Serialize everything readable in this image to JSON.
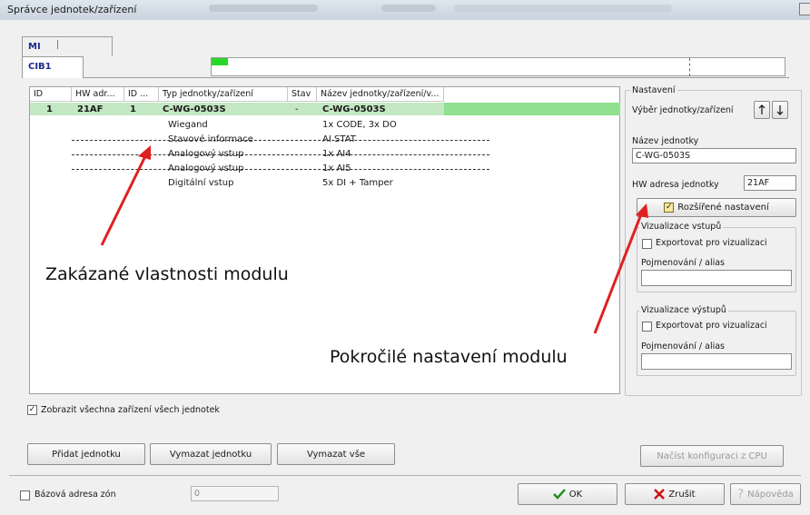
{
  "window": {
    "title": "Správce jednotek/zařízení"
  },
  "tabs": {
    "top": "MI",
    "bottom": "CIB1"
  },
  "colors": {
    "progress": "#28d828",
    "row_highlight": "#c3e8c3",
    "row_highlight_right": "#8fe08f",
    "arrow": "#e02020",
    "ok_check": "#1a8a1a",
    "cancel_x": "#cc1010"
  },
  "table": {
    "columns": [
      "ID",
      "HW adr...",
      "ID ...",
      "Typ jednotky/zařízení",
      "Stav",
      "Název jednotky/zařízení/v..."
    ],
    "main_row": {
      "id": "1",
      "hw": "21AF",
      "id2": "1",
      "type": "C-WG-0503S",
      "state": "-",
      "name": "C-WG-0503S"
    },
    "sub_rows": [
      {
        "type": "Wiegand",
        "name": "1x CODE, 3x DO",
        "disabled": false
      },
      {
        "type": "Stavové informace",
        "name": "AI STAT",
        "disabled": true
      },
      {
        "type": "Analogový vstup",
        "name": "1x AI4",
        "disabled": true
      },
      {
        "type": "Analogový vstup",
        "name": "1x AI5",
        "disabled": true
      },
      {
        "type": "Digitální vstup",
        "name": "5x DI + Tamper",
        "disabled": false
      }
    ]
  },
  "panel": {
    "group_title": "Nastavení",
    "select_label": "Výběr jednotky/zařízení",
    "name_label": "Název jednotky",
    "name_value": "C-WG-0503S",
    "hw_label": "HW adresa jednotky",
    "hw_value": "21AF",
    "advanced_button": "Rozšířené nastavení",
    "inputs_group": "Vizualizace vstupů",
    "inputs_export": "Exportovat pro vizualizaci",
    "inputs_alias_label": "Pojmenování / alias",
    "outputs_group": "Vizualizace výstupů",
    "outputs_export": "Exportovat pro vizualizaci",
    "outputs_alias_label": "Pojmenování / alias"
  },
  "show_all": {
    "label": "Zobrazit všechna zařízení všech jednotek",
    "checked": true
  },
  "buttons": {
    "add": "Přidat jednotku",
    "delete": "Vymazat jednotku",
    "delete_all": "Vymazat vše",
    "load_cpu": "Načíst konfiguraci z CPU",
    "ok": "OK",
    "cancel": "Zrušit",
    "help": "Nápověda"
  },
  "zone": {
    "label": "Bázová adresa zón",
    "value": "0"
  },
  "annotations": {
    "disabled_props": "Zakázané vlastnosti modulu",
    "advanced_settings": "Pokročilé nastavení modulu"
  }
}
